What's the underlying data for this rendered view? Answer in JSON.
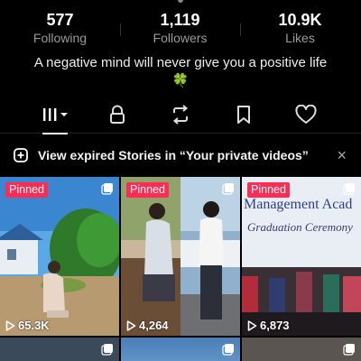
{
  "stats": [
    {
      "value": "577",
      "label": "Following"
    },
    {
      "value": "1,119",
      "label": "Followers"
    },
    {
      "value": "10.9K",
      "label": "Likes"
    }
  ],
  "bio": "A negative mind will never give you a positive life🍀",
  "tabs": [
    {
      "icon": "grid-icon",
      "active": true
    },
    {
      "icon": "lock-icon"
    },
    {
      "icon": "repost-icon"
    },
    {
      "icon": "bookmark-icon"
    },
    {
      "icon": "heart-icon"
    }
  ],
  "banner": {
    "text": "View expired Stories in “Your private videos”",
    "close": "×"
  },
  "videos": [
    {
      "pinned_label": "Pinned",
      "views": "65.3K"
    },
    {
      "pinned_label": "Pinned",
      "views": "4,264"
    },
    {
      "pinned_label": "Pinned",
      "views": "6,873",
      "overlay_title": "Management Acad",
      "overlay_subtitle": "Graduation Ceremony"
    }
  ],
  "colors": {
    "pinned": "#fe2c55",
    "background": "#000000"
  }
}
